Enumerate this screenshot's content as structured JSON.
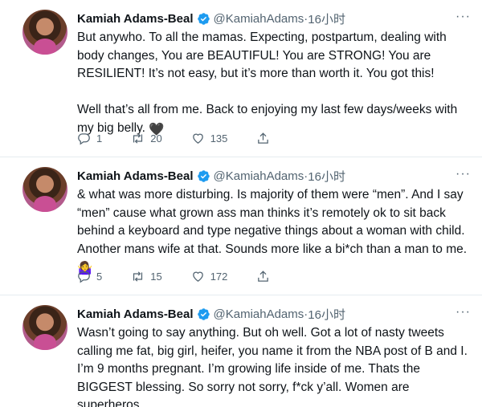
{
  "tweets": [
    {
      "author": {
        "name": "Kamiah Adams-Beal",
        "handle": "@KamiahAdams"
      },
      "separator": "·",
      "time": "16小时",
      "text": "But anywho. To all the mamas. Expecting, postpartum, dealing with\nbody changes, You are BEAUTIFUL! You are STRONG! You are\nRESILIENT! It’s not easy, but it’s more than worth it. You got this!\n\nWell that’s all from me. Back to enjoying my last few days/weeks with\nmy big belly. ",
      "emoji": "🖤",
      "actions": {
        "reply_count": "1",
        "retweet_count": "20",
        "like_count": "135"
      }
    },
    {
      "author": {
        "name": "Kamiah Adams-Beal",
        "handle": "@KamiahAdams"
      },
      "separator": "·",
      "time": "16小时",
      "text": "& what was more disturbing. Is majority of them were “men”. And I say\n“men” cause what grown ass man thinks it’s remotely ok to sit back\nbehind a keyboard and type negative things about a woman with child.\nAnother mans wife at that. Sounds more like a bi*ch than a man to me.\n",
      "emoji": "🤷‍♀️",
      "actions": {
        "reply_count": "5",
        "retweet_count": "15",
        "like_count": "172"
      }
    },
    {
      "author": {
        "name": "Kamiah Adams-Beal",
        "handle": "@KamiahAdams"
      },
      "separator": "·",
      "time": "16小时",
      "text": "Wasn’t going to say anything. But oh well. Got a lot of nasty tweets\ncalling me fat, big girl, heifer, you name it from the NBA post of B and I.\nI’m 9 months pregnant. I’m growing life inside of me. Thats the\nBIGGEST blessing. So sorry not sorry, f*ck y’all. Women are\nsuperheros."
    }
  ],
  "colors": {
    "verified": "#1d9bf0",
    "muted": "#536471",
    "text": "#0f1419"
  },
  "icons": {
    "more": "more-horizontal-icon",
    "reply": "reply-icon",
    "retweet": "retweet-icon",
    "like": "heart-icon",
    "share": "share-icon",
    "verified": "verified-badge-icon"
  }
}
